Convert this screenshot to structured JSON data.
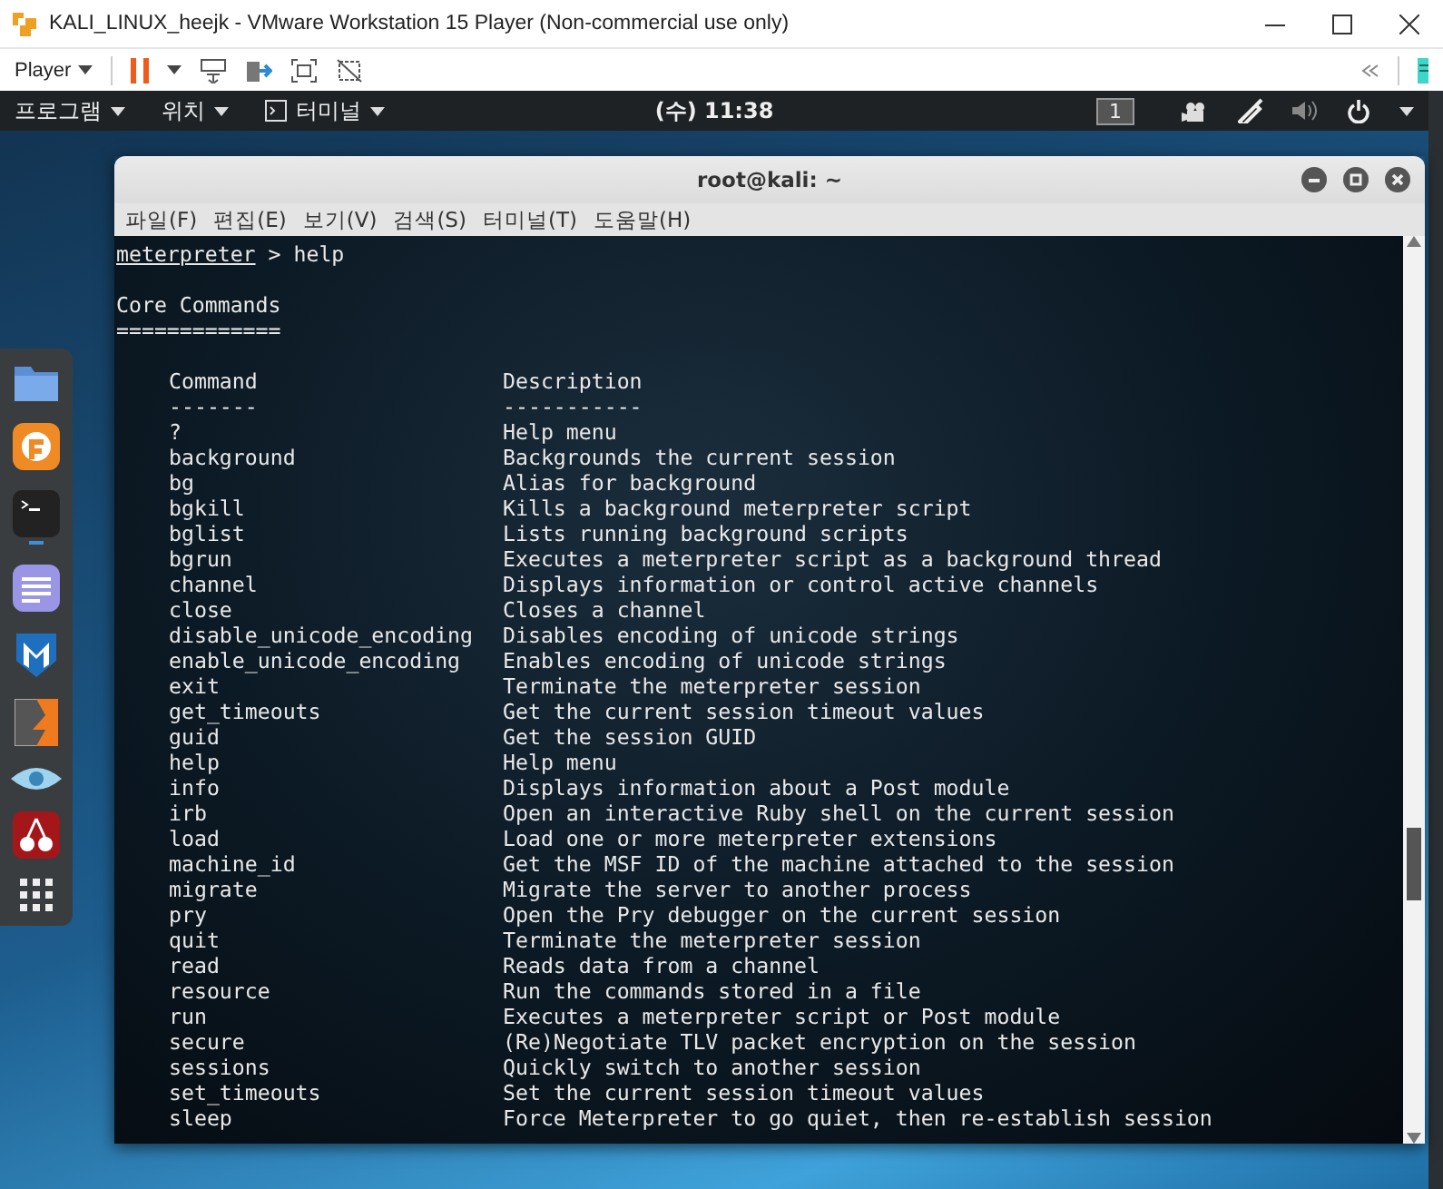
{
  "window": {
    "title": "KALI_LINUX_heejk - VMware Workstation 15 Player (Non-commercial use only)"
  },
  "toolbar": {
    "player_menu": "Player"
  },
  "top_bar": {
    "menus": [
      "프로그램",
      "위치",
      "터미널"
    ],
    "clock": "(수) 11:38",
    "workspace": "1"
  },
  "dock": {
    "items": [
      {
        "kind": "folder",
        "running": false
      },
      {
        "kind": "browser",
        "running": false
      },
      {
        "kind": "terminal",
        "running": true
      },
      {
        "kind": "notes",
        "running": false
      },
      {
        "kind": "shield",
        "running": false
      },
      {
        "kind": "bolt",
        "running": false
      },
      {
        "kind": "eye",
        "running": false
      },
      {
        "kind": "cherry",
        "running": false
      },
      {
        "kind": "grid",
        "running": false
      }
    ]
  },
  "terminal": {
    "title": "root@kali: ~",
    "menus": [
      "파일(F)",
      "편집(E)",
      "보기(V)",
      "검색(S)",
      "터미널(T)",
      "도움말(H)"
    ],
    "prompt": "meterpreter",
    "prompt_sign": ">",
    "command": "help",
    "section_title": "Core Commands",
    "section_rule": "=============",
    "columns": [
      "Command",
      "Description"
    ],
    "column_rules": [
      "-------",
      "-----------"
    ],
    "rows": [
      {
        "command": "?",
        "description": "Help menu"
      },
      {
        "command": "background",
        "description": "Backgrounds the current session"
      },
      {
        "command": "bg",
        "description": "Alias for background"
      },
      {
        "command": "bgkill",
        "description": "Kills a background meterpreter script"
      },
      {
        "command": "bglist",
        "description": "Lists running background scripts"
      },
      {
        "command": "bgrun",
        "description": "Executes a meterpreter script as a background thread"
      },
      {
        "command": "channel",
        "description": "Displays information or control active channels"
      },
      {
        "command": "close",
        "description": "Closes a channel"
      },
      {
        "command": "disable_unicode_encoding",
        "description": "Disables encoding of unicode strings"
      },
      {
        "command": "enable_unicode_encoding",
        "description": "Enables encoding of unicode strings"
      },
      {
        "command": "exit",
        "description": "Terminate the meterpreter session"
      },
      {
        "command": "get_timeouts",
        "description": "Get the current session timeout values"
      },
      {
        "command": "guid",
        "description": "Get the session GUID"
      },
      {
        "command": "help",
        "description": "Help menu"
      },
      {
        "command": "info",
        "description": "Displays information about a Post module"
      },
      {
        "command": "irb",
        "description": "Open an interactive Ruby shell on the current session"
      },
      {
        "command": "load",
        "description": "Load one or more meterpreter extensions"
      },
      {
        "command": "machine_id",
        "description": "Get the MSF ID of the machine attached to the session"
      },
      {
        "command": "migrate",
        "description": "Migrate the server to another process"
      },
      {
        "command": "pry",
        "description": "Open the Pry debugger on the current session"
      },
      {
        "command": "quit",
        "description": "Terminate the meterpreter session"
      },
      {
        "command": "read",
        "description": "Reads data from a channel"
      },
      {
        "command": "resource",
        "description": "Run the commands stored in a file"
      },
      {
        "command": "run",
        "description": "Executes a meterpreter script or Post module"
      },
      {
        "command": "secure",
        "description": "(Re)Negotiate TLV packet encryption on the session"
      },
      {
        "command": "sessions",
        "description": "Quickly switch to another session"
      },
      {
        "command": "set_timeouts",
        "description": "Set the current session timeout values"
      },
      {
        "command": "sleep",
        "description": "Force Meterpreter to go quiet, then re-establish session"
      }
    ]
  }
}
